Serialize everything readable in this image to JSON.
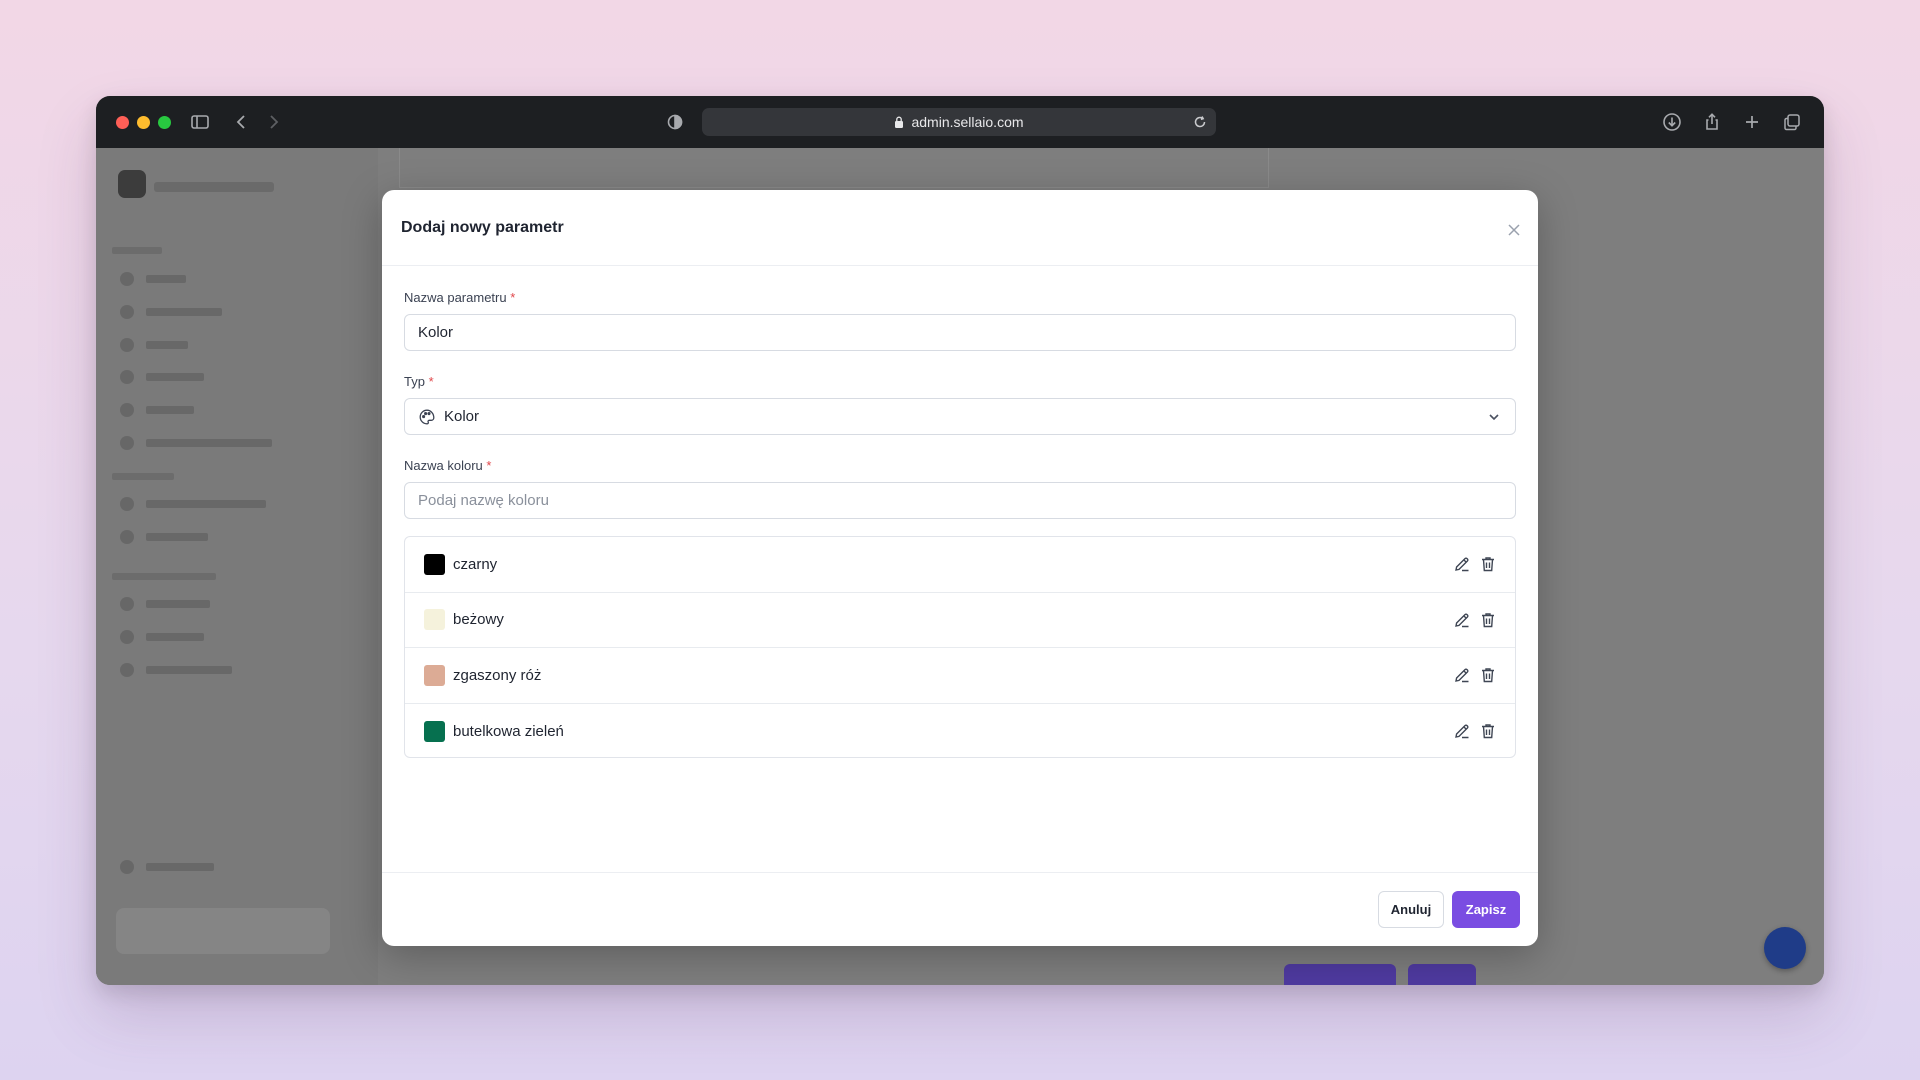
{
  "browser": {
    "url": "admin.sellaio.com"
  },
  "modal": {
    "title": "Dodaj nowy parametr",
    "name_field": {
      "label": "Nazwa parametru",
      "required_mark": "*",
      "value": "Kolor"
    },
    "type_field": {
      "label": "Typ",
      "required_mark": "*",
      "value": "Kolor",
      "icon": "palette-icon"
    },
    "color_name_field": {
      "label": "Nazwa koloru",
      "required_mark": "*",
      "placeholder": "Podaj nazwę koloru"
    },
    "colors": [
      {
        "name": "czarny",
        "swatch": "#000000"
      },
      {
        "name": "beżowy",
        "swatch": "#f5f2dc"
      },
      {
        "name": "zgaszony róż",
        "swatch": "#dcab95"
      },
      {
        "name": "butelkowa zieleń",
        "swatch": "#06704f"
      }
    ],
    "footer": {
      "cancel_label": "Anuluj",
      "save_label": "Zapisz"
    }
  },
  "theme": {
    "accent": "#7a4de2",
    "required": "#e0464a"
  }
}
